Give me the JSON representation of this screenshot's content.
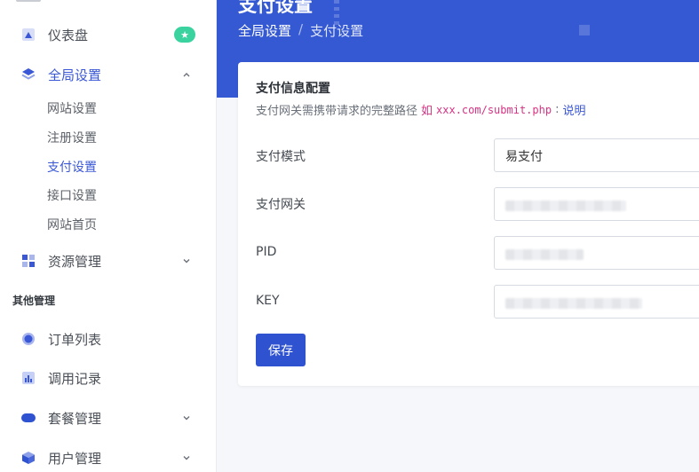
{
  "header": {
    "title": "支付设置",
    "breadcrumb": [
      "全局设置",
      "支付设置"
    ],
    "separator": "/"
  },
  "sidebar": {
    "items": [
      {
        "label": "仪表盘",
        "icon": "dashboard-icon",
        "badge": "★"
      },
      {
        "label": "全局设置",
        "icon": "layers-icon",
        "expanded": true,
        "children": [
          "网站设置",
          "注册设置",
          "支付设置",
          "接口设置",
          "网站首页"
        ]
      },
      {
        "label": "资源管理",
        "icon": "grid-icon",
        "expanded": false
      }
    ],
    "section_title": "其他管理",
    "other_items": [
      {
        "label": "订单列表",
        "icon": "circle-icon"
      },
      {
        "label": "调用记录",
        "icon": "chart-icon"
      },
      {
        "label": "套餐管理",
        "icon": "pill-icon"
      },
      {
        "label": "用户管理",
        "icon": "cube-icon"
      }
    ]
  },
  "card": {
    "title": "支付信息配置",
    "desc_prefix": "支付网关需携带请求的完整路径",
    "desc_example_word": "如",
    "desc_code": "xxx.com/submit.php",
    "desc_separator": ":",
    "desc_link": "说明",
    "fields": [
      {
        "label": "支付模式",
        "value": "易支付"
      },
      {
        "label": "支付网关",
        "value": ""
      },
      {
        "label": "PID",
        "value": ""
      },
      {
        "label": "KEY",
        "value": ""
      }
    ],
    "save_label": "保存"
  },
  "colors": {
    "primary": "#3559d3",
    "button": "#2f52d0",
    "badge": "#3ad29f",
    "code": "#d63384"
  }
}
